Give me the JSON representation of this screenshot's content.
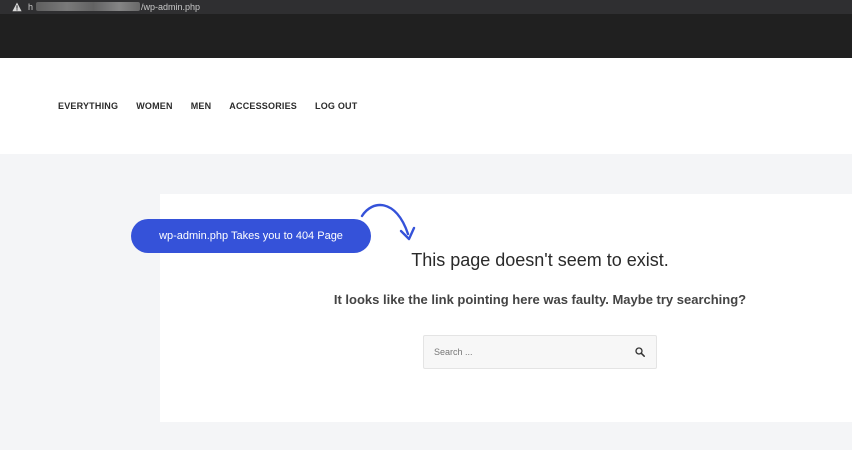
{
  "browser": {
    "url_prefix": "h",
    "url_suffix": "/wp-admin.php",
    "warning_icon": "warning-icon"
  },
  "nav": {
    "items": [
      {
        "label": "EVERYTHING"
      },
      {
        "label": "WOMEN"
      },
      {
        "label": "MEN"
      },
      {
        "label": "ACCESSORIES"
      },
      {
        "label": "LOG OUT"
      }
    ]
  },
  "error_page": {
    "title": "This page doesn't seem to exist.",
    "subtitle": "It looks like the link pointing here was faulty. Maybe try searching?",
    "search_placeholder": "Search ...",
    "search_icon": "search-icon"
  },
  "annotation": {
    "text": "wp-admin.php Takes you to 404 Page",
    "color": "#3552d9"
  }
}
